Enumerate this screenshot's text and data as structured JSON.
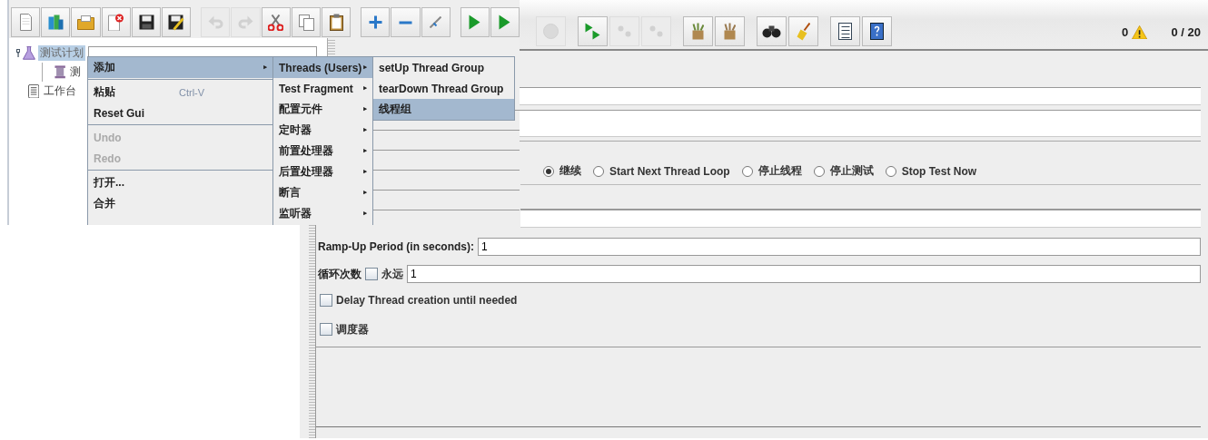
{
  "main_window": {
    "toolbar": [
      {
        "kind": "shutdown",
        "disabled": true
      },
      {
        "kind": "gap"
      },
      {
        "kind": "remote_start",
        "disabled": false
      },
      {
        "kind": "remote_stop",
        "disabled": true
      },
      {
        "kind": "remote_shutdown",
        "disabled": true
      },
      {
        "kind": "gap"
      },
      {
        "kind": "clear",
        "disabled": false
      },
      {
        "kind": "clear_all",
        "disabled": false
      },
      {
        "kind": "gap"
      },
      {
        "kind": "search",
        "disabled": false
      },
      {
        "kind": "reset_search",
        "disabled": false
      },
      {
        "kind": "gap"
      },
      {
        "kind": "function_helper",
        "disabled": false
      },
      {
        "kind": "help",
        "disabled": false
      }
    ],
    "status": {
      "error_count": "0",
      "threads": "0 / 20"
    },
    "form": {
      "error_actions": [
        {
          "label": "继续",
          "selected": true
        },
        {
          "label": "Start Next Thread Loop",
          "selected": false
        },
        {
          "label": "停止线程",
          "selected": false
        },
        {
          "label": "停止测试",
          "selected": false
        },
        {
          "label": "Stop Test Now",
          "selected": false
        }
      ],
      "ramp_up": {
        "label": "Ramp-Up Period (in seconds):",
        "value": "1"
      },
      "loop_count": {
        "label": "循环次数",
        "forever": {
          "label": "永远",
          "checked": false
        },
        "value": "1"
      },
      "delay_creation": {
        "label": "Delay Thread creation until needed",
        "checked": false
      },
      "scheduler": {
        "label": "调度器",
        "checked": false
      }
    }
  },
  "editor_window": {
    "toolbar": [
      {
        "kind": "new",
        "disabled": false
      },
      {
        "kind": "templates",
        "disabled": false
      },
      {
        "kind": "open",
        "disabled": false
      },
      {
        "kind": "close",
        "disabled": false
      },
      {
        "kind": "save",
        "disabled": false
      },
      {
        "kind": "save_as",
        "disabled": false
      },
      {
        "kind": "gap"
      },
      {
        "kind": "undo",
        "disabled": true
      },
      {
        "kind": "redo",
        "disabled": true
      },
      {
        "kind": "cut",
        "disabled": false
      },
      {
        "kind": "copy",
        "disabled": false
      },
      {
        "kind": "paste",
        "disabled": false
      },
      {
        "kind": "gap"
      },
      {
        "kind": "expand",
        "disabled": false
      },
      {
        "kind": "collapse",
        "disabled": false
      },
      {
        "kind": "toggle",
        "disabled": false
      },
      {
        "kind": "gap"
      },
      {
        "kind": "start",
        "disabled": false
      },
      {
        "kind": "start",
        "disabled": false
      }
    ],
    "tree": [
      {
        "kind": "test_plan",
        "label": "测试计划",
        "selected": true,
        "expanded": true,
        "children": [
          {
            "kind": "thread_group",
            "label": "测",
            "selected": false
          }
        ]
      },
      {
        "kind": "workbench",
        "label": "工作台",
        "selected": false
      }
    ],
    "context_menu": [
      {
        "kind": "item",
        "label": "添加",
        "selected": true,
        "disabled": false,
        "submenu": true
      },
      {
        "kind": "separator"
      },
      {
        "kind": "item",
        "label": "粘贴",
        "shortcut": "Ctrl-V",
        "selected": false,
        "disabled": false,
        "submenu": false
      },
      {
        "kind": "item",
        "label": "Reset Gui",
        "selected": false,
        "disabled": false,
        "submenu": false
      },
      {
        "kind": "separator"
      },
      {
        "kind": "item",
        "label": "Undo",
        "selected": false,
        "disabled": true,
        "submenu": false
      },
      {
        "kind": "item",
        "label": "Redo",
        "selected": false,
        "disabled": true,
        "submenu": false
      },
      {
        "kind": "separator"
      },
      {
        "kind": "item",
        "label": "打开...",
        "selected": false,
        "disabled": false,
        "submenu": false
      },
      {
        "kind": "item",
        "label": "合并",
        "selected": false,
        "disabled": false,
        "submenu": false
      }
    ],
    "add_submenu": [
      {
        "kind": "item",
        "label": "Threads (Users)",
        "selected": true,
        "disabled": false,
        "submenu": true
      },
      {
        "kind": "item",
        "label": "Test Fragment",
        "selected": false,
        "disabled": false,
        "submenu": true
      },
      {
        "kind": "item",
        "label": "配置元件",
        "selected": false,
        "disabled": false,
        "submenu": true
      },
      {
        "kind": "item",
        "label": "定时器",
        "selected": false,
        "disabled": false,
        "submenu": true
      },
      {
        "kind": "item",
        "label": "前置处理器",
        "selected": false,
        "disabled": false,
        "submenu": true
      },
      {
        "kind": "item",
        "label": "后置处理器",
        "selected": false,
        "disabled": false,
        "submenu": true
      },
      {
        "kind": "item",
        "label": "断言",
        "selected": false,
        "disabled": false,
        "submenu": true
      },
      {
        "kind": "item",
        "label": "监听器",
        "selected": false,
        "disabled": false,
        "submenu": true
      }
    ],
    "threads_submenu": [
      {
        "kind": "item",
        "label": "setUp Thread Group",
        "selected": false,
        "disabled": false,
        "submenu": false
      },
      {
        "kind": "item",
        "label": "tearDown Thread Group",
        "selected": false,
        "disabled": false,
        "submenu": false
      },
      {
        "kind": "item",
        "label": "线程组",
        "selected": true,
        "disabled": false,
        "submenu": false
      }
    ]
  }
}
